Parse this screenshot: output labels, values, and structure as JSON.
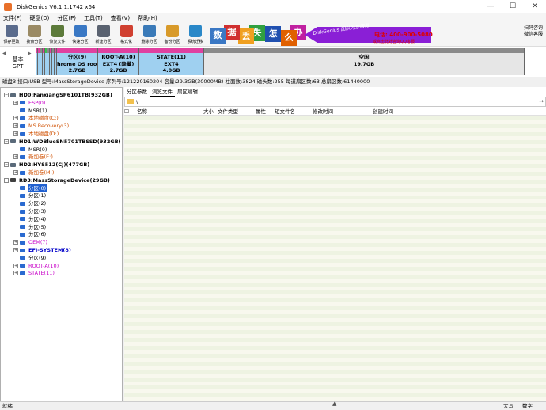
{
  "window": {
    "title": "DiskGenius V6.1.1.1742 x64",
    "min": "—",
    "max": "☐",
    "close": "✕"
  },
  "menu": [
    "文件(F)",
    "硬盘(D)",
    "分区(P)",
    "工具(T)",
    "查看(V)",
    "帮助(H)"
  ],
  "toolbar": [
    {
      "label": "保存更改",
      "icon": "save-icon",
      "color": "#5a6b8c"
    },
    {
      "label": "搜索分区",
      "icon": "search-partition-icon",
      "color": "#9a8a64"
    },
    {
      "label": "恢复文件",
      "icon": "recover-file-icon",
      "color": "#5c7a3a"
    },
    {
      "label": "快速分区",
      "icon": "quick-partition-icon",
      "color": "#3a78c4"
    },
    {
      "label": "新建分区",
      "icon": "new-partition-icon",
      "color": "#5a6270"
    },
    {
      "label": "格式化",
      "icon": "format-icon",
      "color": "#d04030"
    },
    {
      "label": "删除分区",
      "icon": "delete-partition-icon",
      "color": "#3a7ab8"
    },
    {
      "label": "备份分区",
      "icon": "backup-partition-icon",
      "color": "#d89a2a"
    },
    {
      "label": "系统迁移",
      "icon": "system-migrate-icon",
      "color": "#2a88c8"
    }
  ],
  "banner": {
    "tiles": [
      "数",
      "据",
      "丢",
      "失",
      "怎",
      "么",
      "办"
    ],
    "slogan": "DiskGenius 团队为您服务",
    "phone": "电话: 400-900-5080",
    "qq": "或点击此处咨询QQ客服"
  },
  "qr_text": [
    "扫码咨询",
    "微信客服"
  ],
  "diskbar": {
    "type_line1": "基本",
    "type_line2": "GPT",
    "partitions": [
      {
        "name": "",
        "fs": "",
        "size": "",
        "width": 2,
        "top": "#e040a0",
        "body": "#9fd0f0"
      },
      {
        "name": "",
        "fs": "",
        "size": "",
        "width": 3,
        "top": "#e040a0",
        "body": "#9fd0f0"
      },
      {
        "name": "",
        "fs": "",
        "size": "",
        "width": 3,
        "top": "#8a8a8a",
        "body": "#9fd0f0"
      },
      {
        "name": "",
        "fs": "",
        "size": "",
        "width": 3,
        "top": "#e040a0",
        "body": "#9fd0f0"
      },
      {
        "name": "",
        "fs": "",
        "size": "",
        "width": 3,
        "top": "#3ac050",
        "body": "#9fd0f0"
      },
      {
        "name": "",
        "fs": "",
        "size": "",
        "width": 3,
        "top": "#8a8a8a",
        "body": "#9fd0f0"
      },
      {
        "name": "",
        "fs": "",
        "size": "",
        "width": 3,
        "top": "#e040a0",
        "body": "#9fd0f0"
      },
      {
        "name": "",
        "fs": "",
        "size": "",
        "width": 3,
        "top": "#8a8a8a",
        "body": "#9fd0f0"
      },
      {
        "name": "",
        "fs": "",
        "size": "",
        "width": 3,
        "top": "#e040a0",
        "body": "#9fd0f0"
      },
      {
        "name": "分区(9)",
        "fs": "hrome OS root",
        "size": "2.7GB",
        "width": 52,
        "top": "#e040a0",
        "body": "#9fd0f0"
      },
      {
        "name": "ROOT-A(10)",
        "fs": "EXT4 (隐藏)",
        "size": "2.7GB",
        "width": 52,
        "top": "#e040a0",
        "body": "#9fd0f0"
      },
      {
        "name": "STATE(11)",
        "fs": "EXT4",
        "size": "4.0GB",
        "width": 82,
        "top": "#e040a0",
        "body": "#9fd0f0"
      },
      {
        "name": "空闲",
        "fs": "19.7GB",
        "size": "",
        "width": 405,
        "top": "#8a8a8a",
        "body": "#e6e6e6"
      }
    ]
  },
  "infobar": "磁盘3 接口:USB  型号:MassStorageDevice  序列号:121220160204  容量:29.3GB(30000MB)  柱面数:3824  磁头数:255  每道扇区数:63  总扇区数:61440000",
  "tree": [
    {
      "text": "HD0:FanxiangSP6101TB(932GB)",
      "level": 0,
      "exp": "−",
      "bold": true,
      "color": "#000000",
      "icon": "disk"
    },
    {
      "text": "ESP(0)",
      "level": 1,
      "exp": "+",
      "bold": false,
      "color": "#c800c8",
      "icon": "part"
    },
    {
      "text": "MSR(1)",
      "level": 1,
      "exp": "",
      "bold": false,
      "color": "#000000",
      "icon": "part"
    },
    {
      "text": "本地磁盘(C:)",
      "level": 1,
      "exp": "+",
      "bold": false,
      "color": "#d05000",
      "icon": "part"
    },
    {
      "text": "MS Recovery(3)",
      "level": 1,
      "exp": "+",
      "bold": false,
      "color": "#d05000",
      "icon": "part"
    },
    {
      "text": "本地磁盘(D:)",
      "level": 1,
      "exp": "+",
      "bold": false,
      "color": "#d05000",
      "icon": "part"
    },
    {
      "text": "HD1:WDBlueSN5701TBSSD(932GB)",
      "level": 0,
      "exp": "−",
      "bold": true,
      "color": "#000000",
      "icon": "disk"
    },
    {
      "text": "MSR(0)",
      "level": 1,
      "exp": "",
      "bold": false,
      "color": "#000000",
      "icon": "part"
    },
    {
      "text": "新加卷(E:)",
      "level": 1,
      "exp": "+",
      "bold": false,
      "color": "#d05000",
      "icon": "part"
    },
    {
      "text": "HD2:HYS512(CJ)(477GB)",
      "level": 0,
      "exp": "−",
      "bold": true,
      "color": "#000000",
      "icon": "disk"
    },
    {
      "text": "新加卷(M:)",
      "level": 1,
      "exp": "+",
      "bold": false,
      "color": "#d05000",
      "icon": "part"
    },
    {
      "text": "RD3:MassStorageDevice(29GB)",
      "level": 0,
      "exp": "−",
      "bold": true,
      "color": "#000000",
      "icon": "usb"
    },
    {
      "text": "分区(0)",
      "level": 1,
      "exp": "",
      "bold": false,
      "color": "#ffffff",
      "icon": "part",
      "selected": true
    },
    {
      "text": "分区(1)",
      "level": 1,
      "exp": "",
      "bold": false,
      "color": "#000000",
      "icon": "part"
    },
    {
      "text": "分区(2)",
      "level": 1,
      "exp": "",
      "bold": false,
      "color": "#000000",
      "icon": "part"
    },
    {
      "text": "分区(3)",
      "level": 1,
      "exp": "",
      "bold": false,
      "color": "#000000",
      "icon": "part"
    },
    {
      "text": "分区(4)",
      "level": 1,
      "exp": "",
      "bold": false,
      "color": "#000000",
      "icon": "part"
    },
    {
      "text": "分区(5)",
      "level": 1,
      "exp": "",
      "bold": false,
      "color": "#000000",
      "icon": "part"
    },
    {
      "text": "分区(6)",
      "level": 1,
      "exp": "",
      "bold": false,
      "color": "#000000",
      "icon": "part"
    },
    {
      "text": "OEM(7)",
      "level": 1,
      "exp": "+",
      "bold": false,
      "color": "#c800c8",
      "icon": "part"
    },
    {
      "text": "EFI-SYSTEM(8)",
      "level": 1,
      "exp": "+",
      "bold": true,
      "color": "#0000c8",
      "icon": "part"
    },
    {
      "text": "分区(9)",
      "level": 1,
      "exp": "",
      "bold": false,
      "color": "#000000",
      "icon": "part"
    },
    {
      "text": "ROOT-A(10)",
      "level": 1,
      "exp": "+",
      "bold": false,
      "color": "#c800c8",
      "icon": "part"
    },
    {
      "text": "STATE(11)",
      "level": 1,
      "exp": "+",
      "bold": false,
      "color": "#c800c8",
      "icon": "part"
    }
  ],
  "tabs": [
    "分区参数",
    "浏览文件",
    "扇区编辑"
  ],
  "path": "\\",
  "columns": [
    "名称",
    "大小",
    "文件类型",
    "属性",
    "短文件名",
    "修改时间",
    "创建时间"
  ],
  "status": {
    "left": "就绪",
    "caps": "大写",
    "num": "数字"
  }
}
